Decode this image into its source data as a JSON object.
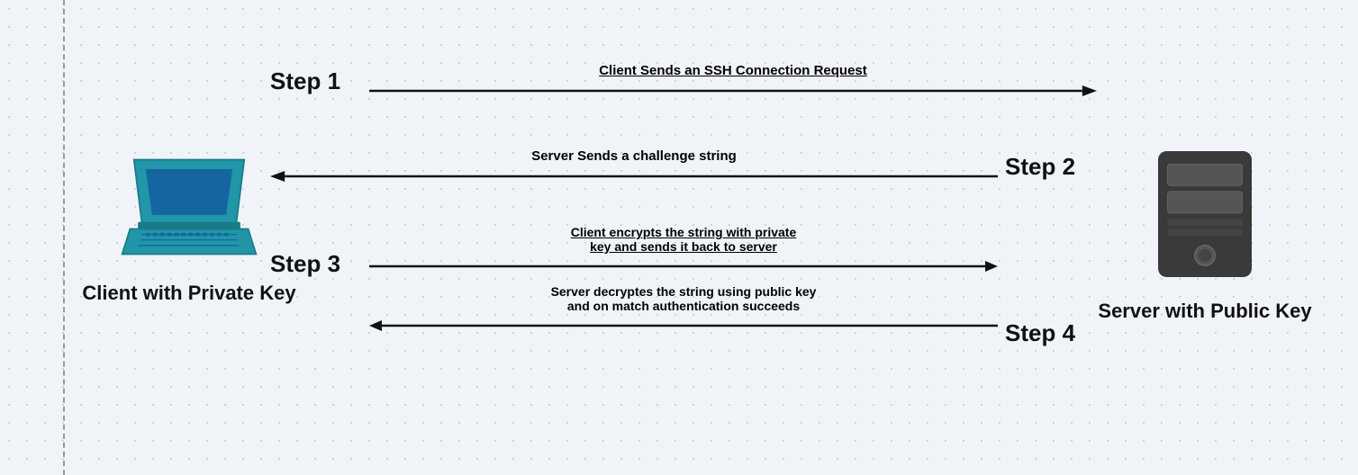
{
  "diagram": {
    "background": "dotted light blue-gray",
    "left_dashed_line": true,
    "client": {
      "label": "Client with Private Key"
    },
    "server": {
      "label": "Server with Public Key"
    },
    "steps": [
      {
        "id": "step1",
        "label": "Step 1",
        "position": "left",
        "text": "Client Sends an SSH Connection Request",
        "underline": true,
        "direction": "right",
        "arrow_style": "right"
      },
      {
        "id": "step2",
        "label": "Step 2",
        "position": "right",
        "text": "Server Sends a challenge string",
        "underline": false,
        "direction": "left",
        "arrow_style": "left"
      },
      {
        "id": "step3",
        "label": "Step 3",
        "position": "left",
        "text_line1": "Client encrypts the string with private",
        "text_line2": "key and sends it back to server",
        "underline": true,
        "direction": "right",
        "arrow_style": "right",
        "sub_text_line1": "Server decryptes the string using public key",
        "sub_text_line2": "and on match authentication succeeds"
      },
      {
        "id": "step4",
        "label": "Step 4",
        "position": "right",
        "direction": "left",
        "arrow_style": "left"
      }
    ]
  }
}
